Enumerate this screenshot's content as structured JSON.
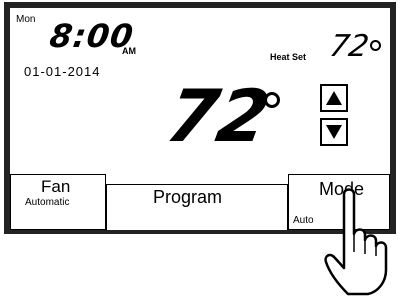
{
  "clock": {
    "day": "Mon",
    "time": "8:00",
    "ampm": "AM",
    "date": "01-01-2014"
  },
  "heat_set": {
    "label": "Heat Set",
    "temp": "72"
  },
  "current_temp": "72",
  "buttons": {
    "fan": {
      "label": "Fan",
      "sub": "Automatic"
    },
    "program": {
      "label": "Program"
    },
    "mode": {
      "label": "Mode",
      "sub": "Auto"
    }
  },
  "icons": [
    "up-arrow-icon",
    "down-arrow-icon",
    "pointing-hand-icon",
    "degree-symbol-icon"
  ]
}
